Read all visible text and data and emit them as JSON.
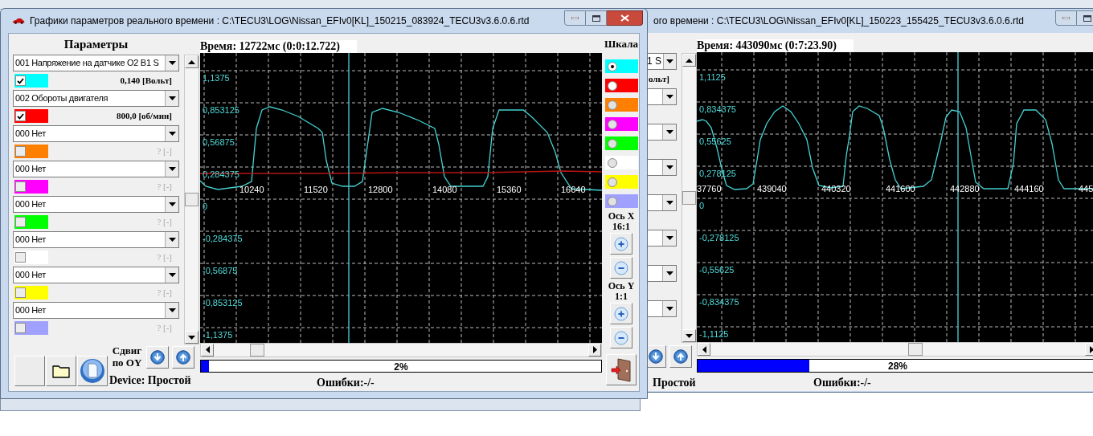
{
  "window": {
    "title": "Графики параметров реального времени : C:\\TECU3\\LOG\\Nissan_EFIv0[KL]_150215_083924_TECU3v3.6.0.6.rtd",
    "params_header": "Параметры",
    "params": [
      {
        "channel": "001 Напряжение на датчике O2 B1 S",
        "color": "#00ffff",
        "checked": true,
        "reading": "0,140 [Вольт]"
      },
      {
        "channel": "002 Обороты двигателя",
        "color": "#ff0000",
        "checked": true,
        "reading": "800,0 [об/мин]"
      },
      {
        "channel": "000 Нет",
        "color": "#ff8000",
        "checked": false,
        "reading": "? [-]"
      },
      {
        "channel": "000 Нет",
        "color": "#ff00ff",
        "checked": false,
        "reading": "? [-]"
      },
      {
        "channel": "000 Нет",
        "color": "#00ff00",
        "checked": false,
        "reading": "? [-]"
      },
      {
        "channel": "000 Нет",
        "color": "#ffffff",
        "checked": false,
        "reading": "? [-]"
      },
      {
        "channel": "000 Нет",
        "color": "#ffff00",
        "checked": false,
        "reading": "? [-]"
      },
      {
        "channel": "000 Нет",
        "color": "#a0a0ff",
        "checked": false,
        "reading": "? [-]"
      }
    ],
    "shift_label": "Сдвиг по OY",
    "device": "Device: Простой",
    "chart": {
      "time": "Время: 12722мс (0:0:12.722)",
      "y_labels": [
        "1,1375",
        "0,853125",
        "0,56875",
        "0,284375",
        "0",
        "-0,284375",
        "-0,56875",
        "-0,853125",
        "-1,1375"
      ],
      "x_labels": [
        "10240",
        "11520",
        "12800",
        "14080",
        "15360",
        "16640"
      ]
    },
    "progress": {
      "level": 0.02,
      "text": "2%"
    },
    "errors": "Ошибки:-/-",
    "scale_header": "Шкала",
    "scales": [
      {
        "color": "#00ffff",
        "selected": true,
        "disabled": false
      },
      {
        "color": "#ff0000",
        "selected": false,
        "disabled": false
      },
      {
        "color": "#ff8000",
        "selected": false,
        "disabled": true
      },
      {
        "color": "#ff00ff",
        "selected": false,
        "disabled": true
      },
      {
        "color": "#00ff00",
        "selected": false,
        "disabled": true
      },
      {
        "color": "#ffffff",
        "selected": false,
        "disabled": true
      },
      {
        "color": "#ffff00",
        "selected": false,
        "disabled": true
      },
      {
        "color": "#a0a0ff",
        "selected": false,
        "disabled": true
      }
    ],
    "x_axis": {
      "label": "Ось X",
      "ratio": "16:1"
    },
    "y_axis": {
      "label": "Ось Y",
      "ratio": "1:1"
    }
  },
  "background_window": {
    "title": "ого времени : C:\\TECU3\\LOG\\Nissan_EFIv0[KL]_150223_155425_TECU3v3.6.0.6.rtd",
    "params": [
      {
        "kind": "dropdown",
        "channel": "1 S",
        "reading": "ольт]"
      },
      {
        "kind": "dropdown"
      },
      {
        "kind": "dropdown"
      },
      {
        "kind": "dropdown"
      },
      {
        "kind": "dropdown"
      },
      {
        "kind": "dropdown"
      },
      {
        "kind": "dropdown"
      },
      {
        "kind": "dropdown"
      }
    ],
    "device": "Простой",
    "chart": {
      "time": "Время: 443090мс (0:7:23.90)",
      "y_labels": [
        "1,1125",
        "0,834375",
        "0,55625",
        "0,278125",
        "0",
        "-0,278125",
        "-0,55625",
        "-0,834375",
        "-1,1125"
      ],
      "x_labels": [
        "37760",
        "439040",
        "440320",
        "441600",
        "442880",
        "444160",
        "445"
      ]
    },
    "progress": {
      "level": 0.28,
      "text": "28%"
    },
    "errors": "Ошибки:-/-"
  }
}
